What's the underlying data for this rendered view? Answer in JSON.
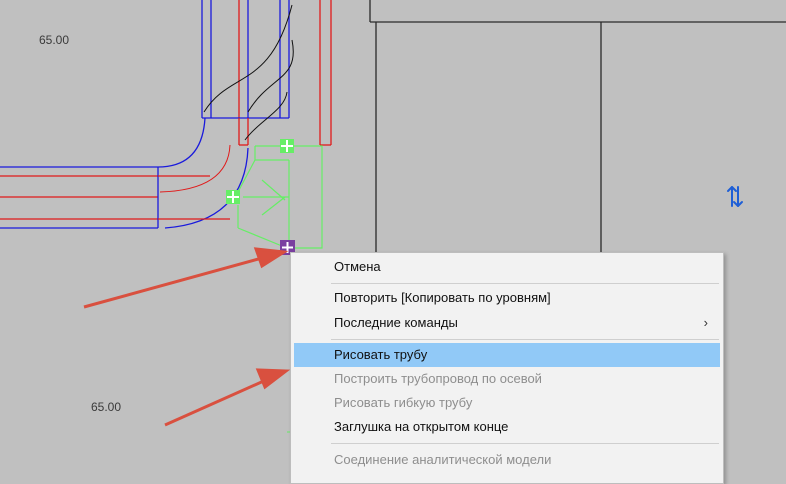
{
  "drawing": {
    "dimension_labels": [
      "65.00",
      "65.00"
    ]
  },
  "colors": {
    "background": "#c0c0c0",
    "pipe_blue": "#1a1adc",
    "pipe_red": "#e01a1a",
    "selection_green": "#66ee66",
    "arrow": "#d9503f",
    "menu_highlight": "#91c9f7"
  },
  "icons": {
    "flip": "flip-arrows-icon",
    "grip_plus": "connector-grip-icon",
    "grip_end": "open-end-grip-icon"
  },
  "context_menu": {
    "items": [
      {
        "label": "Отмена",
        "enabled": true
      },
      {
        "label": "Повторить [Копировать по уровням]",
        "enabled": true
      },
      {
        "label": "Последние команды",
        "enabled": true,
        "has_submenu": true,
        "submenu_glyph": "›"
      },
      {
        "label": "Рисовать трубу",
        "enabled": true,
        "highlighted": true
      },
      {
        "label": "Построить трубопровод по осевой",
        "enabled": false
      },
      {
        "label": "Рисовать гибкую трубу",
        "enabled": false
      },
      {
        "label": "Заглушка на открытом конце",
        "enabled": true
      },
      {
        "label": "Соединение аналитической модели",
        "enabled": false
      }
    ]
  }
}
